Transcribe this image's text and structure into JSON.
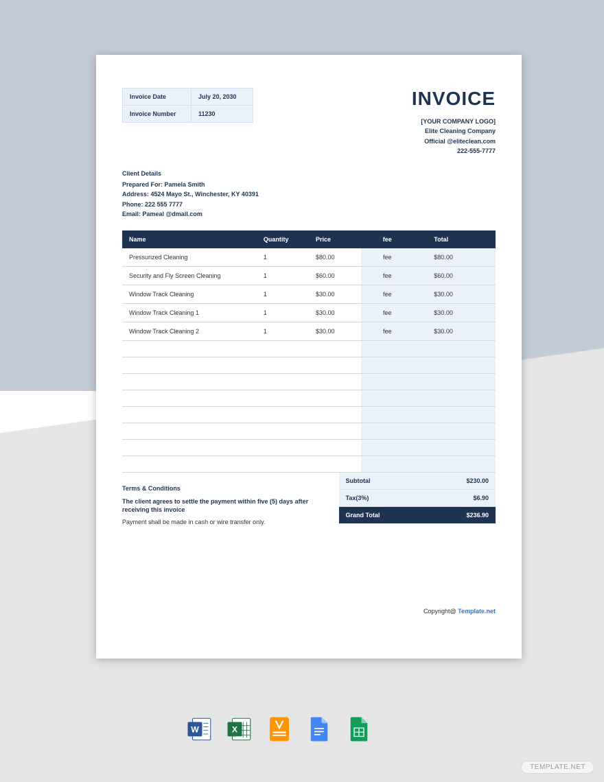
{
  "header": {
    "title": "INVOICE",
    "meta": {
      "date_label": "Invoice Date",
      "date_value": "July 20, 2030",
      "number_label": "Invoice Number",
      "number_value": "11230"
    },
    "company": {
      "logo_placeholder": "[YOUR COMPANY LOGO]",
      "name": "Elite Cleaning Company",
      "email": "Official @eliteclean.com",
      "phone": "222-555-7777"
    }
  },
  "client": {
    "heading": "Client Details",
    "prepared_for": "Prepared For: Pamela Smith",
    "address": "Address: 4524 Mayo St., Winchester, KY 40391",
    "phone": "Phone: 222 555 7777",
    "email": "Email: Pameal @dmail.com"
  },
  "table": {
    "columns": {
      "name": "Name",
      "qty": "Quantity",
      "price": "Price",
      "fee": "fee",
      "total": "Total"
    },
    "rows": [
      {
        "name": "Pressurized Cleaning",
        "qty": "1",
        "price": "$80.00",
        "fee": "fee",
        "total": "$80.00"
      },
      {
        "name": "Security and Fly Screen Cleaning",
        "qty": "1",
        "price": "$60.00",
        "fee": "fee",
        "total": "$60.00"
      },
      {
        "name": "Window Track Cleaning",
        "qty": "1",
        "price": "$30.00",
        "fee": "fee",
        "total": "$30.00"
      },
      {
        "name": "Window Track Cleaning 1",
        "qty": "1",
        "price": "$30.00",
        "fee": "fee",
        "total": "$30.00"
      },
      {
        "name": "Window Track Cleaning 2",
        "qty": "1",
        "price": "$30.00",
        "fee": "fee",
        "total": "$30.00"
      }
    ],
    "empty_rows": 8
  },
  "totals": {
    "subtotal_label": "Subtotal",
    "subtotal_value": "$230.00",
    "tax_label": "Tax(3%)",
    "tax_value": "$6.90",
    "grand_label": "Grand Total",
    "grand_value": "$236.90"
  },
  "terms": {
    "heading": "Terms & Conditions",
    "line1": "The client agrees to settle the payment within five (5) days after receiving this invoice",
    "line2": "Payment shall be made in cash or wire transfer only."
  },
  "copyright": {
    "prefix": "Copyright@ ",
    "link": "Template.net"
  },
  "watermark": "TEMPLATE.NET",
  "format_icons": [
    "word",
    "excel",
    "pages",
    "google-docs",
    "google-sheets"
  ]
}
